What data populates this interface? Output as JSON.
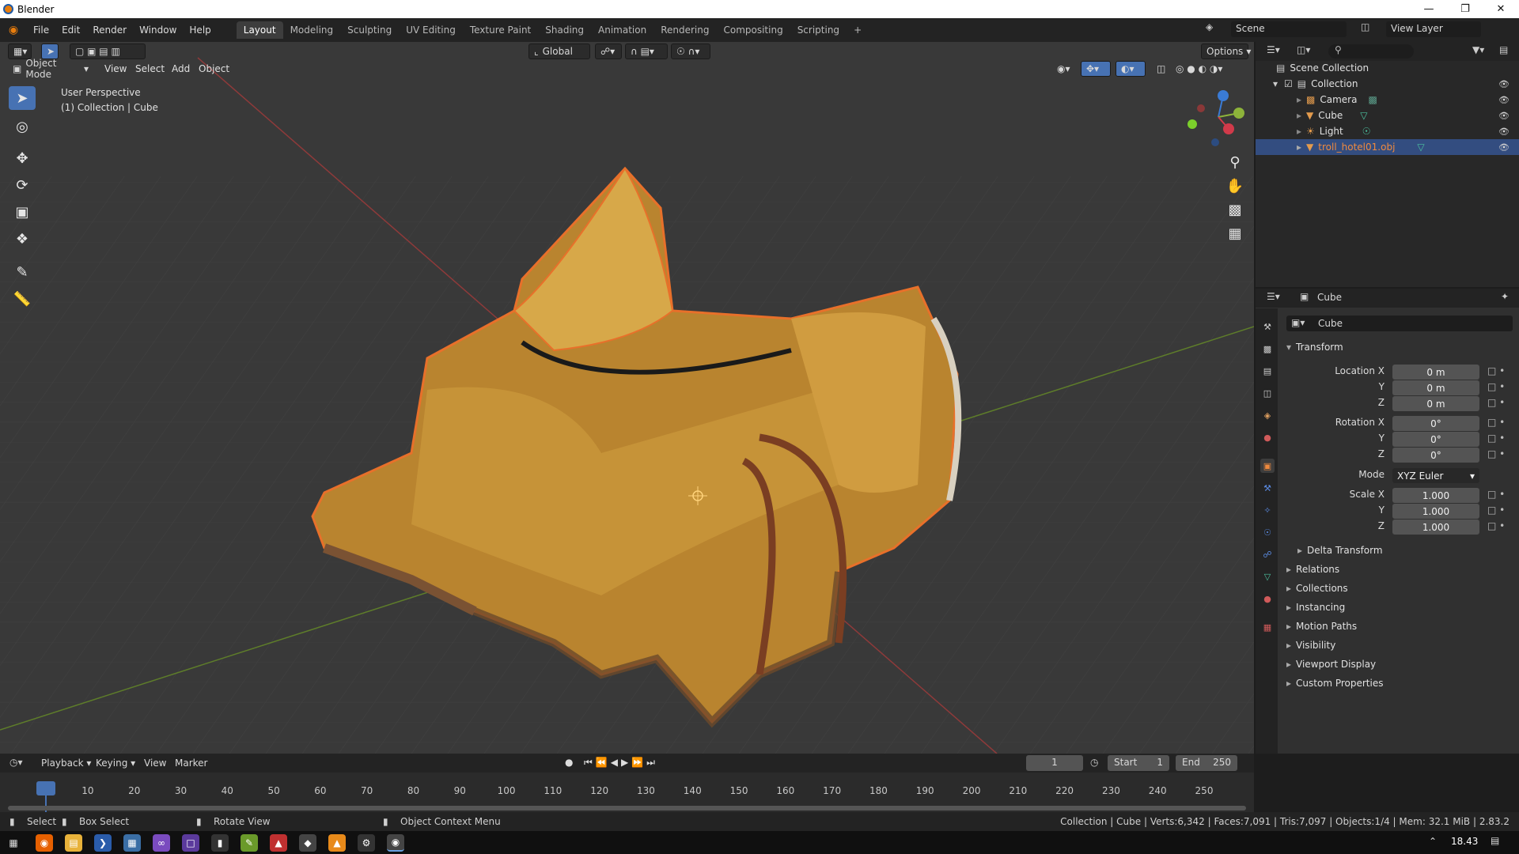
{
  "app": {
    "title": "Blender"
  },
  "menus": [
    "File",
    "Edit",
    "Render",
    "Window",
    "Help"
  ],
  "workspaces": [
    "Layout",
    "Modeling",
    "Sculpting",
    "UV Editing",
    "Texture Paint",
    "Shading",
    "Animation",
    "Rendering",
    "Compositing",
    "Scripting"
  ],
  "active_workspace": "Layout",
  "scene": {
    "label": "Scene",
    "view_layer": "View Layer"
  },
  "viewport_header": {
    "orientation": "Global",
    "options": "Options",
    "mode": "Object Mode",
    "menus": [
      "View",
      "Select",
      "Add",
      "Object"
    ]
  },
  "viewport": {
    "perspective": "User Perspective",
    "context": "(1) Collection | Cube",
    "gizmo_axes": [
      "X",
      "Y",
      "Z"
    ]
  },
  "outliner": {
    "root": "Scene Collection",
    "collection": "Collection",
    "items": [
      {
        "name": "Camera",
        "icon": "camera-icon"
      },
      {
        "name": "Cube",
        "icon": "mesh-icon"
      },
      {
        "name": "Light",
        "icon": "light-icon"
      },
      {
        "name": "troll_hotel01.obj",
        "icon": "mesh-icon",
        "selected": true
      }
    ]
  },
  "properties": {
    "object_name": "Cube",
    "data_name": "Cube",
    "transform_label": "Transform",
    "location_label": "Location X",
    "rotation_label": "Rotation X",
    "scale_label": "Scale X",
    "axis_y": "Y",
    "axis_z": "Z",
    "location": [
      "0 m",
      "0 m",
      "0 m"
    ],
    "rotation": [
      "0°",
      "0°",
      "0°"
    ],
    "mode_label": "Mode",
    "mode_value": "XYZ Euler",
    "scale": [
      "1.000",
      "1.000",
      "1.000"
    ],
    "delta": "Delta Transform",
    "panels": [
      "Relations",
      "Collections",
      "Instancing",
      "Motion Paths",
      "Visibility",
      "Viewport Display",
      "Custom Properties"
    ]
  },
  "timeline": {
    "menus": [
      "Playback",
      "Keying",
      "View",
      "Marker"
    ],
    "current_frame": "1",
    "start_label": "Start",
    "start": "1",
    "end_label": "End",
    "end": "250",
    "ruler": [
      "1",
      "10",
      "20",
      "30",
      "40",
      "50",
      "60",
      "70",
      "80",
      "90",
      "100",
      "110",
      "120",
      "130",
      "140",
      "150",
      "160",
      "170",
      "180",
      "190",
      "200",
      "210",
      "220",
      "230",
      "240",
      "250"
    ]
  },
  "statusbar": {
    "select": "Select",
    "box_select": "Box Select",
    "rotate_view": "Rotate View",
    "context_menu": "Object Context Menu",
    "stats": "Collection | Cube | Verts:6,342 | Faces:7,091 | Tris:7,097 | Objects:1/4 | Mem: 32.1 MiB | 2.83.2"
  },
  "taskbar": {
    "clock": "18.43"
  },
  "colors": {
    "accent": "#4772b3",
    "selection": "#e8702a",
    "header": "#232323",
    "viewport_bg": "#393939"
  }
}
